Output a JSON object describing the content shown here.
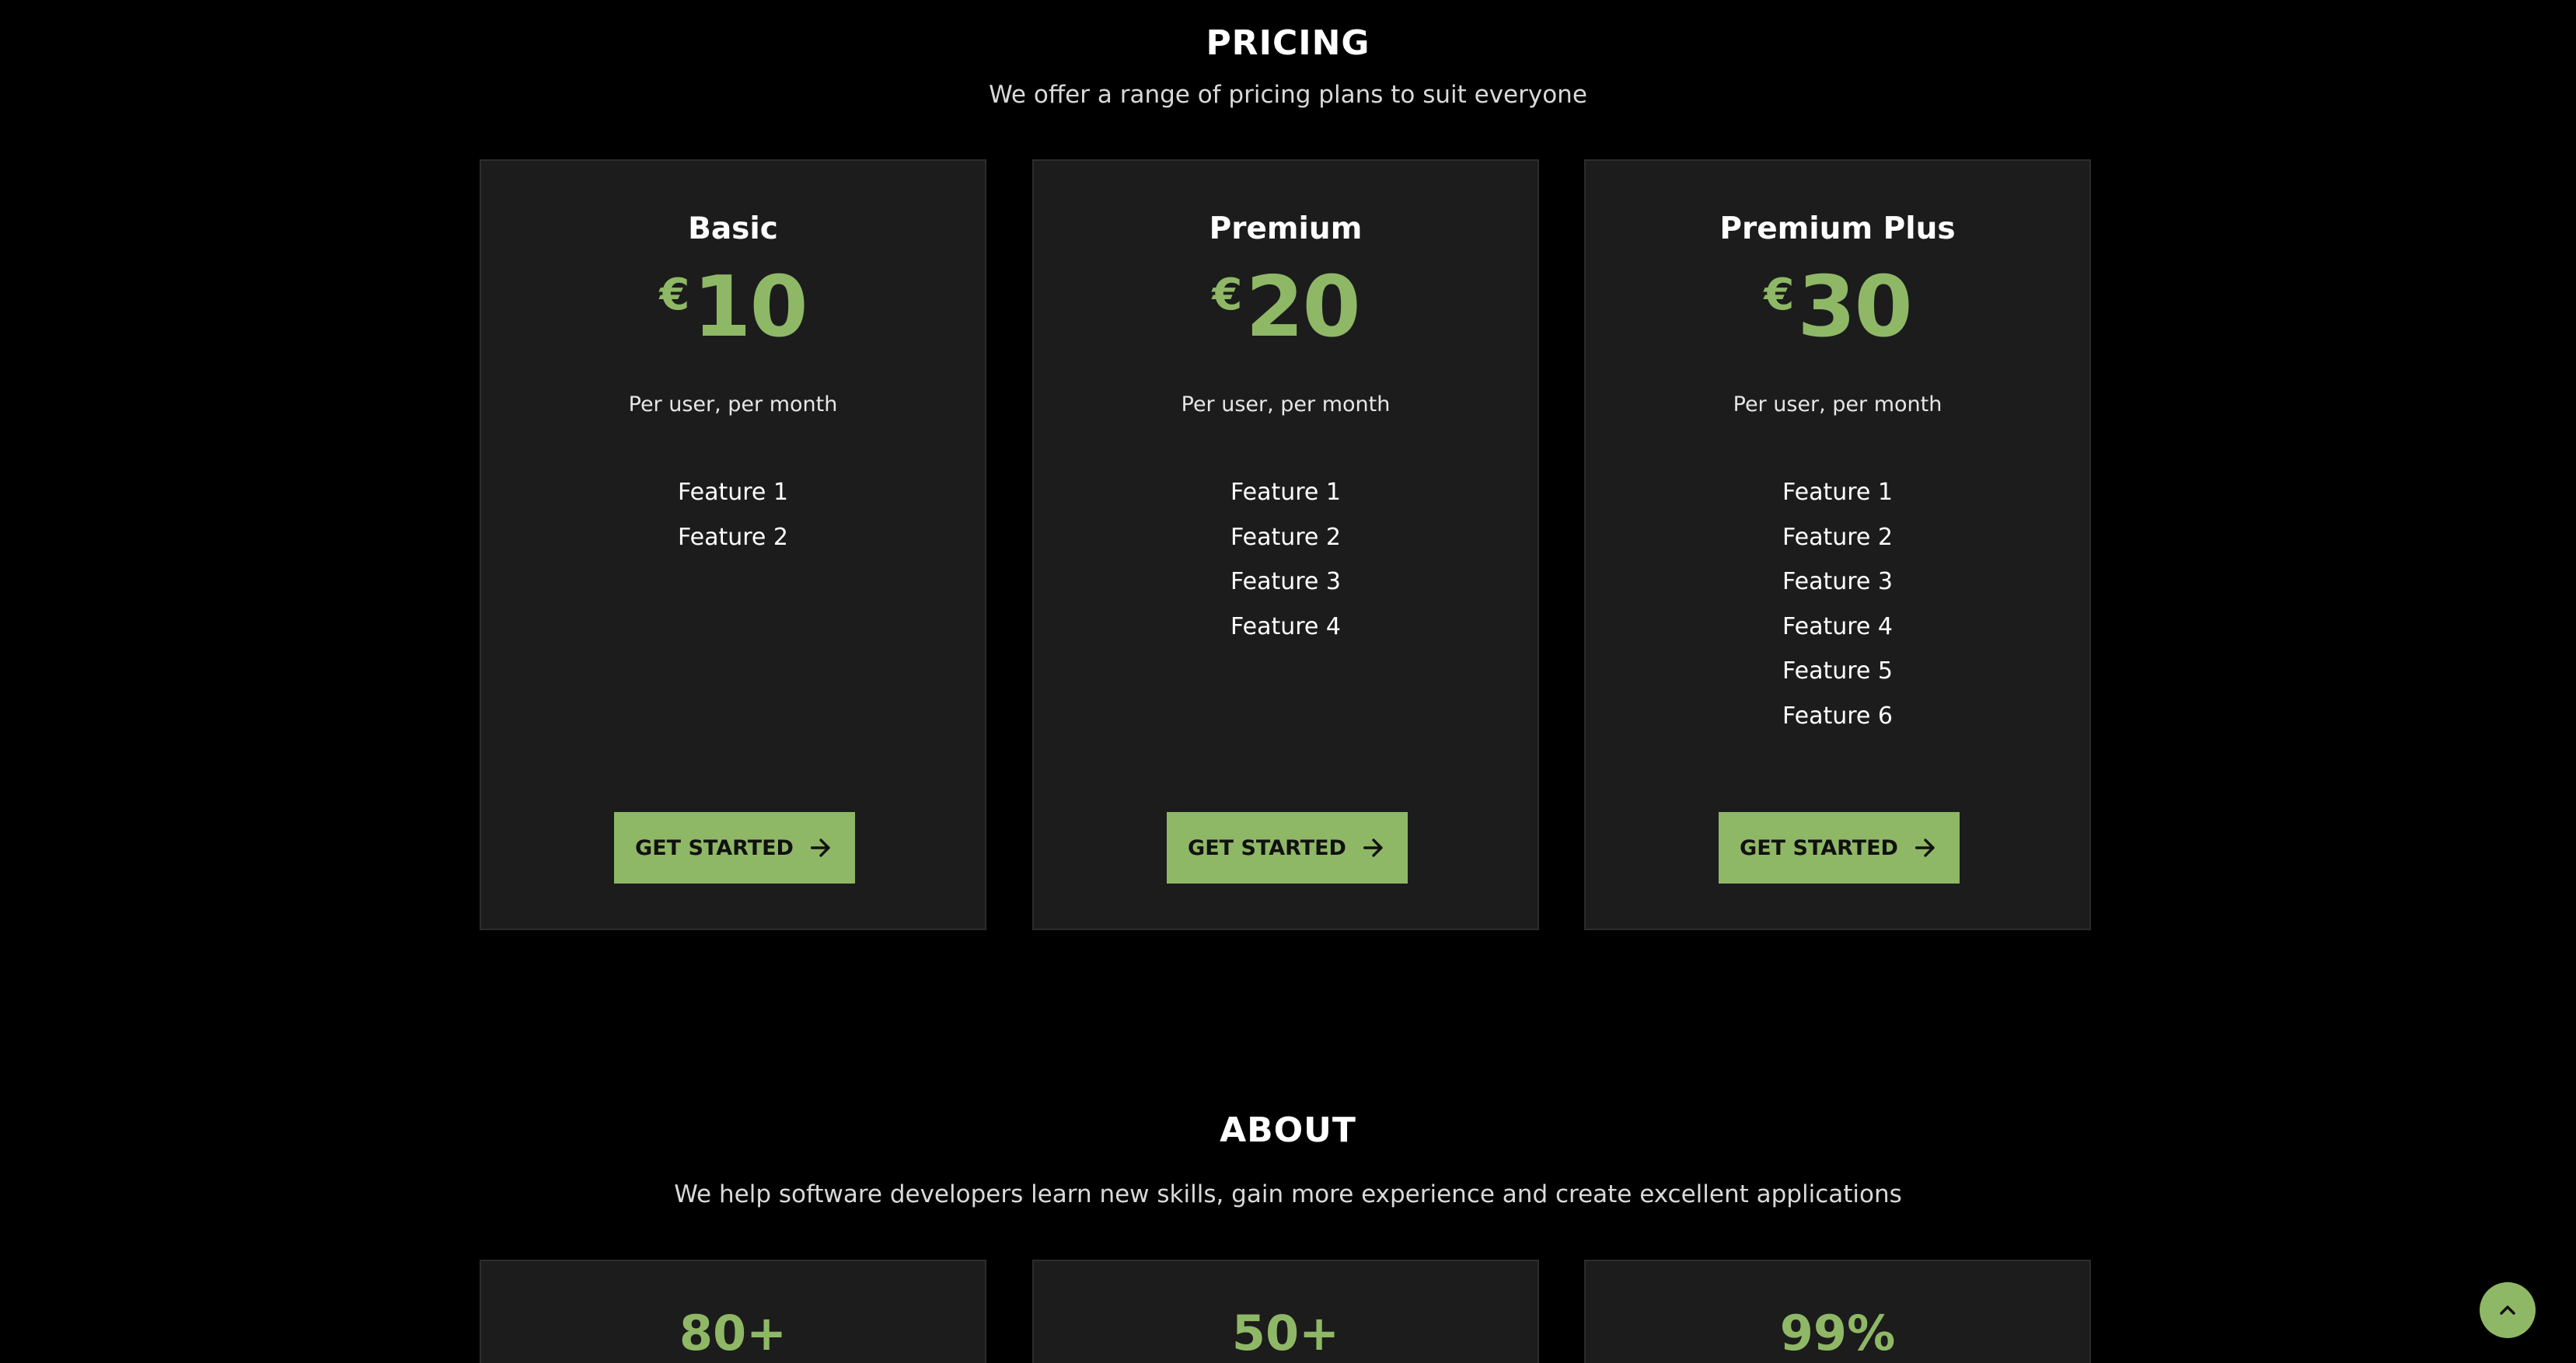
{
  "pricing": {
    "title": "PRICING",
    "subtitle": "We offer a range of pricing plans to suit everyone",
    "plans": [
      {
        "name": "Basic",
        "currency": "€",
        "amount": "10",
        "period": "Per user, per month",
        "features": [
          "Feature 1",
          "Feature 2"
        ],
        "cta": "GET STARTED"
      },
      {
        "name": "Premium",
        "currency": "€",
        "amount": "20",
        "period": "Per user, per month",
        "features": [
          "Feature 1",
          "Feature 2",
          "Feature 3",
          "Feature 4"
        ],
        "cta": "GET STARTED"
      },
      {
        "name": "Premium Plus",
        "currency": "€",
        "amount": "30",
        "period": "Per user, per month",
        "features": [
          "Feature 1",
          "Feature 2",
          "Feature 3",
          "Feature 4",
          "Feature 5",
          "Feature 6"
        ],
        "cta": "GET STARTED"
      }
    ]
  },
  "about": {
    "title": "ABOUT",
    "subtitle": "We help software developers learn new skills, gain more experience and create excellent applications",
    "stats": [
      {
        "value": "80+"
      },
      {
        "value": "50+"
      },
      {
        "value": "99%"
      }
    ]
  },
  "icons": {
    "cta_icon": "arrow-right-icon",
    "back_to_top_icon": "chevron-up-icon"
  },
  "colors": {
    "background": "#000000",
    "card": "#1c1c1c",
    "accent": "#8fb866",
    "text": "#ffffff"
  }
}
